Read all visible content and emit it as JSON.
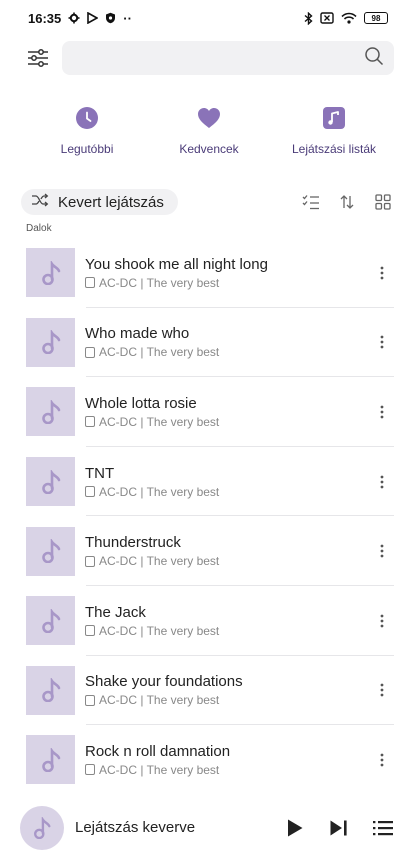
{
  "status": {
    "time": "16:35",
    "left_icons": [
      "gear-icon",
      "play-store-icon",
      "shield-icon"
    ],
    "more": "··",
    "battery": "98"
  },
  "search": {
    "placeholder": ""
  },
  "quicknav": [
    {
      "label": "Legutóbbi",
      "icon": "clock-icon"
    },
    {
      "label": "Kedvencek",
      "icon": "heart-icon"
    },
    {
      "label": "Lejátszási listák",
      "icon": "playlist-icon"
    }
  ],
  "actions": {
    "shuffle_label": "Kevert lejátszás"
  },
  "section_label": "Dalok",
  "songs": [
    {
      "title": "You shook me all night long",
      "subtitle": "AC-DC | The very best"
    },
    {
      "title": "Who made who",
      "subtitle": "AC-DC | The very best"
    },
    {
      "title": "Whole lotta rosie",
      "subtitle": "AC-DC | The very best"
    },
    {
      "title": "TNT",
      "subtitle": "AC-DC | The very best"
    },
    {
      "title": "Thunderstruck",
      "subtitle": "AC-DC | The very best"
    },
    {
      "title": "The Jack",
      "subtitle": "AC-DC | The very best"
    },
    {
      "title": "Shake your foundations",
      "subtitle": "AC-DC | The very best"
    },
    {
      "title": "Rock n roll damnation",
      "subtitle": "AC-DC | The very best"
    }
  ],
  "player": {
    "label": "Lejátszás keverve"
  },
  "colors": {
    "accent": "#8a73b8",
    "thumb_bg": "#d9d3e6",
    "nav_label": "#4a3b78"
  }
}
